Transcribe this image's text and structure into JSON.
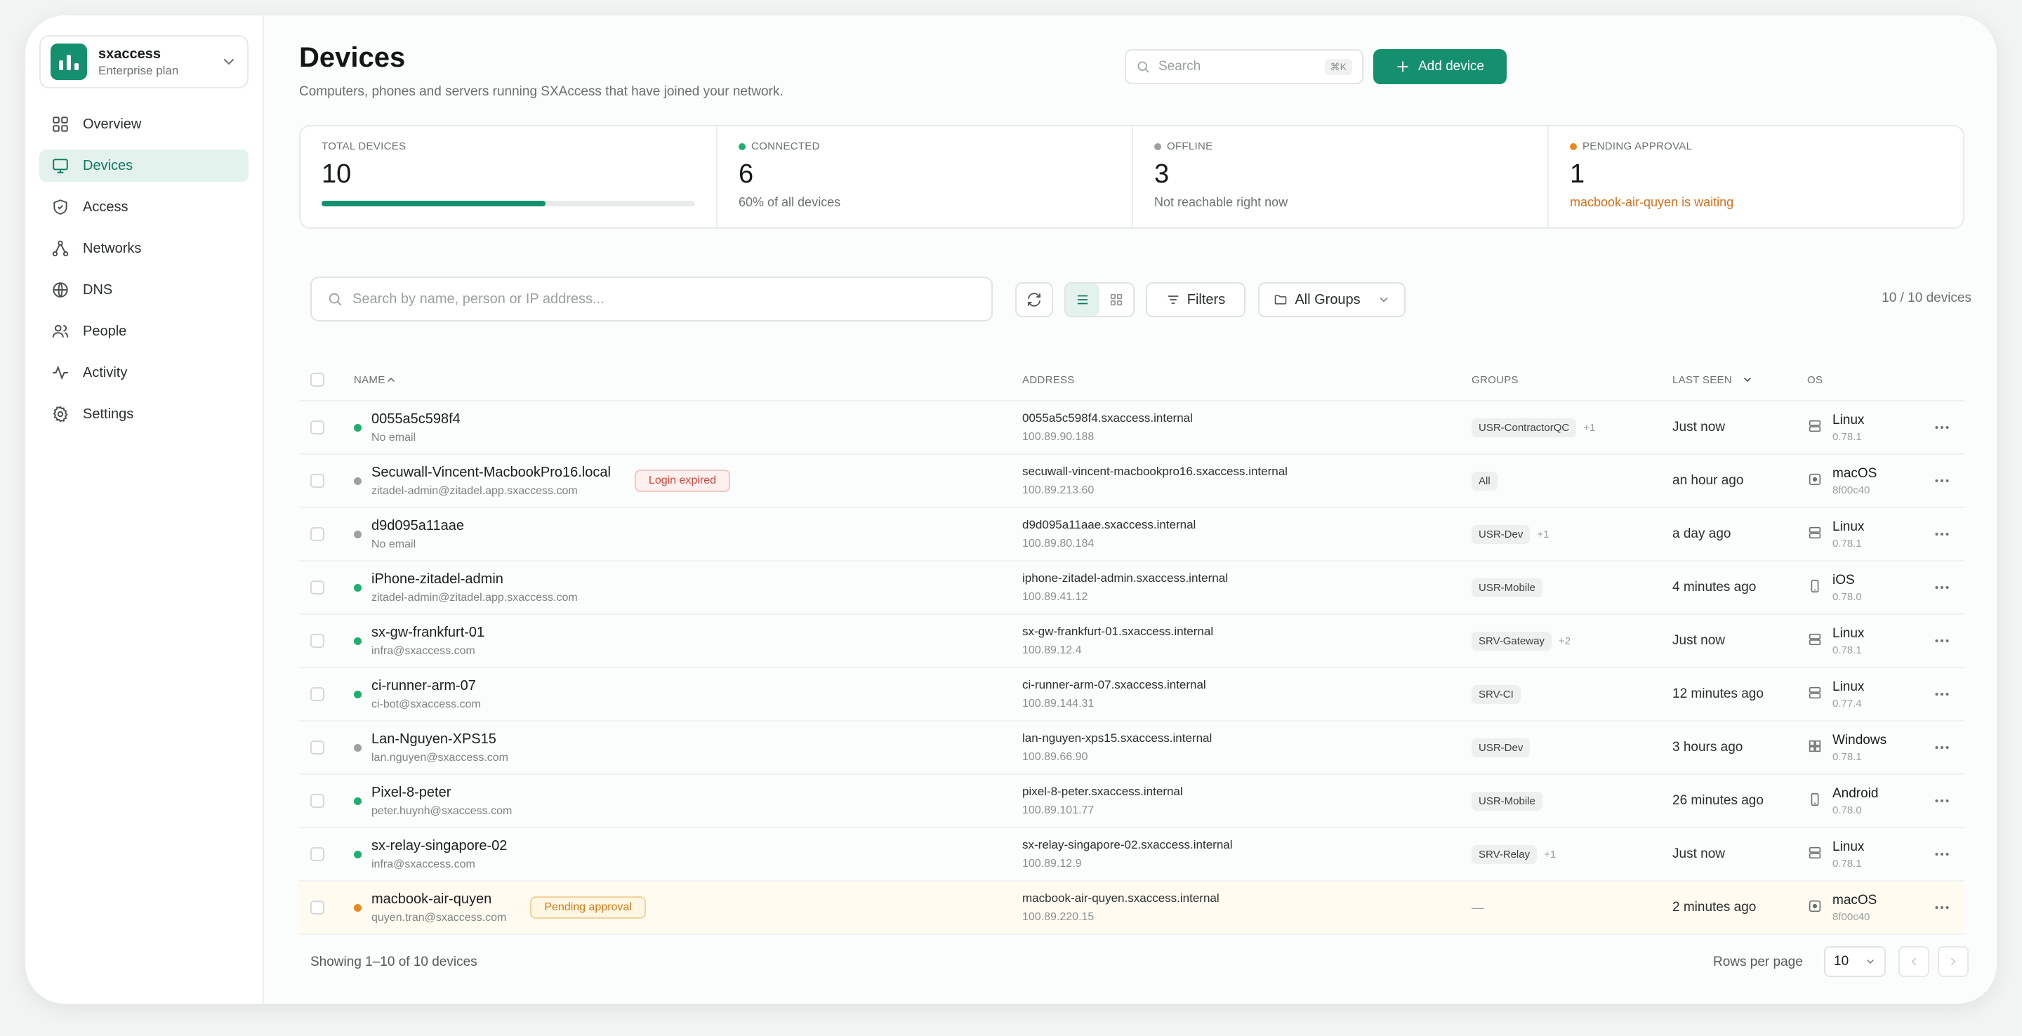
{
  "org": {
    "name": "sxaccess",
    "plan": "Enterprise plan"
  },
  "sidebar": {
    "items": [
      {
        "label": "Overview",
        "icon": "grid-icon"
      },
      {
        "label": "Devices",
        "icon": "monitor-icon",
        "active": true
      },
      {
        "label": "Access",
        "icon": "shield-icon"
      },
      {
        "label": "Networks",
        "icon": "network-icon"
      },
      {
        "label": "DNS",
        "icon": "globe-icon"
      },
      {
        "label": "People",
        "icon": "people-icon"
      },
      {
        "label": "Activity",
        "icon": "activity-icon"
      },
      {
        "label": "Settings",
        "icon": "gear-icon"
      }
    ]
  },
  "header": {
    "title": "Devices",
    "subtitle": "Computers, phones and servers running SXAccess that have joined your network.",
    "search_placeholder": "Search",
    "search_shortcut": "⌘K",
    "add_label": "Add device"
  },
  "stats": {
    "total": {
      "label": "TOTAL DEVICES",
      "value": "10",
      "progress": 0.6
    },
    "connected": {
      "label": "CONNECTED",
      "value": "6",
      "note": "60% of all devices",
      "color": "#1fae6e"
    },
    "offline": {
      "label": "OFFLINE",
      "value": "3",
      "note": "Not reachable right now",
      "color": "#9aa19e"
    },
    "pending": {
      "label": "PENDING APPROVAL",
      "value": "1",
      "note": "macbook-air-quyen is waiting",
      "color": "#e58b1f"
    }
  },
  "toolbar": {
    "search_placeholder": "Search by name, person or IP address...",
    "filters_label": "Filters",
    "groups_label": "All Groups",
    "count": "10 / 10 devices"
  },
  "table": {
    "headers": {
      "name": "NAME",
      "address": "ADDRESS",
      "groups": "GROUPS",
      "last_seen": "LAST SEEN",
      "os": "OS"
    },
    "rows": [
      {
        "name": "0055a5c598f4",
        "sub": "No email",
        "status": "online",
        "badge": "",
        "address": "0055a5c598f4.sxaccess.internal",
        "ip": "100.89.90.188",
        "group": "USR-ContractorQC",
        "extra": "+1",
        "seen": "Just now",
        "os": "Linux",
        "osver": "0.78.1",
        "osicon": "server-icon"
      },
      {
        "name": "Secuwall-Vincent-MacbookPro16.local",
        "sub": "zitadel-admin@zitadel.app.sxaccess.com",
        "status": "offline",
        "badge": "Login expired",
        "badgetype": "red",
        "address": "secuwall-vincent-macbookpro16.sxaccess.internal",
        "ip": "100.89.213.60",
        "group": "All",
        "extra": "",
        "seen": "an hour ago",
        "os": "macOS",
        "osver": "8f00c40",
        "osicon": "apple-icon"
      },
      {
        "name": "d9d095a11aae",
        "sub": "No email",
        "status": "offline",
        "badge": "",
        "address": "d9d095a11aae.sxaccess.internal",
        "ip": "100.89.80.184",
        "group": "USR-Dev",
        "extra": "+1",
        "seen": "a day ago",
        "os": "Linux",
        "osver": "0.78.1",
        "osicon": "server-icon"
      },
      {
        "name": "iPhone-zitadel-admin",
        "sub": "zitadel-admin@zitadel.app.sxaccess.com",
        "status": "online",
        "badge": "",
        "address": "iphone-zitadel-admin.sxaccess.internal",
        "ip": "100.89.41.12",
        "group": "USR-Mobile",
        "extra": "",
        "seen": "4 minutes ago",
        "os": "iOS",
        "osver": "0.78.0",
        "osicon": "phone-icon"
      },
      {
        "name": "sx-gw-frankfurt-01",
        "sub": "infra@sxaccess.com",
        "status": "online",
        "badge": "",
        "address": "sx-gw-frankfurt-01.sxaccess.internal",
        "ip": "100.89.12.4",
        "group": "SRV-Gateway",
        "extra": "+2",
        "seen": "Just now",
        "os": "Linux",
        "osver": "0.78.1",
        "osicon": "server-icon"
      },
      {
        "name": "ci-runner-arm-07",
        "sub": "ci-bot@sxaccess.com",
        "status": "online",
        "badge": "",
        "address": "ci-runner-arm-07.sxaccess.internal",
        "ip": "100.89.144.31",
        "group": "SRV-CI",
        "extra": "",
        "seen": "12 minutes ago",
        "os": "Linux",
        "osver": "0.77.4",
        "osicon": "server-icon"
      },
      {
        "name": "Lan-Nguyen-XPS15",
        "sub": "lan.nguyen@sxaccess.com",
        "status": "offline",
        "badge": "",
        "address": "lan-nguyen-xps15.sxaccess.internal",
        "ip": "100.89.66.90",
        "group": "USR-Dev",
        "extra": "",
        "seen": "3 hours ago",
        "os": "Windows",
        "osver": "0.78.1",
        "osicon": "windows-icon"
      },
      {
        "name": "Pixel-8-peter",
        "sub": "peter.huynh@sxaccess.com",
        "status": "online",
        "badge": "",
        "address": "pixel-8-peter.sxaccess.internal",
        "ip": "100.89.101.77",
        "group": "USR-Mobile",
        "extra": "",
        "seen": "26 minutes ago",
        "os": "Android",
        "osver": "0.78.0",
        "osicon": "phone-icon"
      },
      {
        "name": "sx-relay-singapore-02",
        "sub": "infra@sxaccess.com",
        "status": "online",
        "badge": "",
        "address": "sx-relay-singapore-02.sxaccess.internal",
        "ip": "100.89.12.9",
        "group": "SRV-Relay",
        "extra": "+1",
        "seen": "Just now",
        "os": "Linux",
        "osver": "0.78.1",
        "osicon": "server-icon"
      },
      {
        "name": "macbook-air-quyen",
        "sub": "quyen.tran@sxaccess.com",
        "status": "pending",
        "badge": "Pending approval",
        "badgetype": "amber",
        "address": "macbook-air-quyen.sxaccess.internal",
        "ip": "100.89.220.15",
        "group": "",
        "extra": "",
        "dash": "—",
        "seen": "2 minutes ago",
        "os": "macOS",
        "osver": "8f00c40",
        "osicon": "apple-icon"
      }
    ]
  },
  "footer": {
    "showing": "Showing 1–10 of 10 devices",
    "rows_per_page_label": "Rows per page",
    "rows_per_page": "10"
  },
  "colors": {
    "accent": "#14906f",
    "online": "#1fae6e",
    "offline": "#9aa19e",
    "pending": "#e58b1f"
  }
}
